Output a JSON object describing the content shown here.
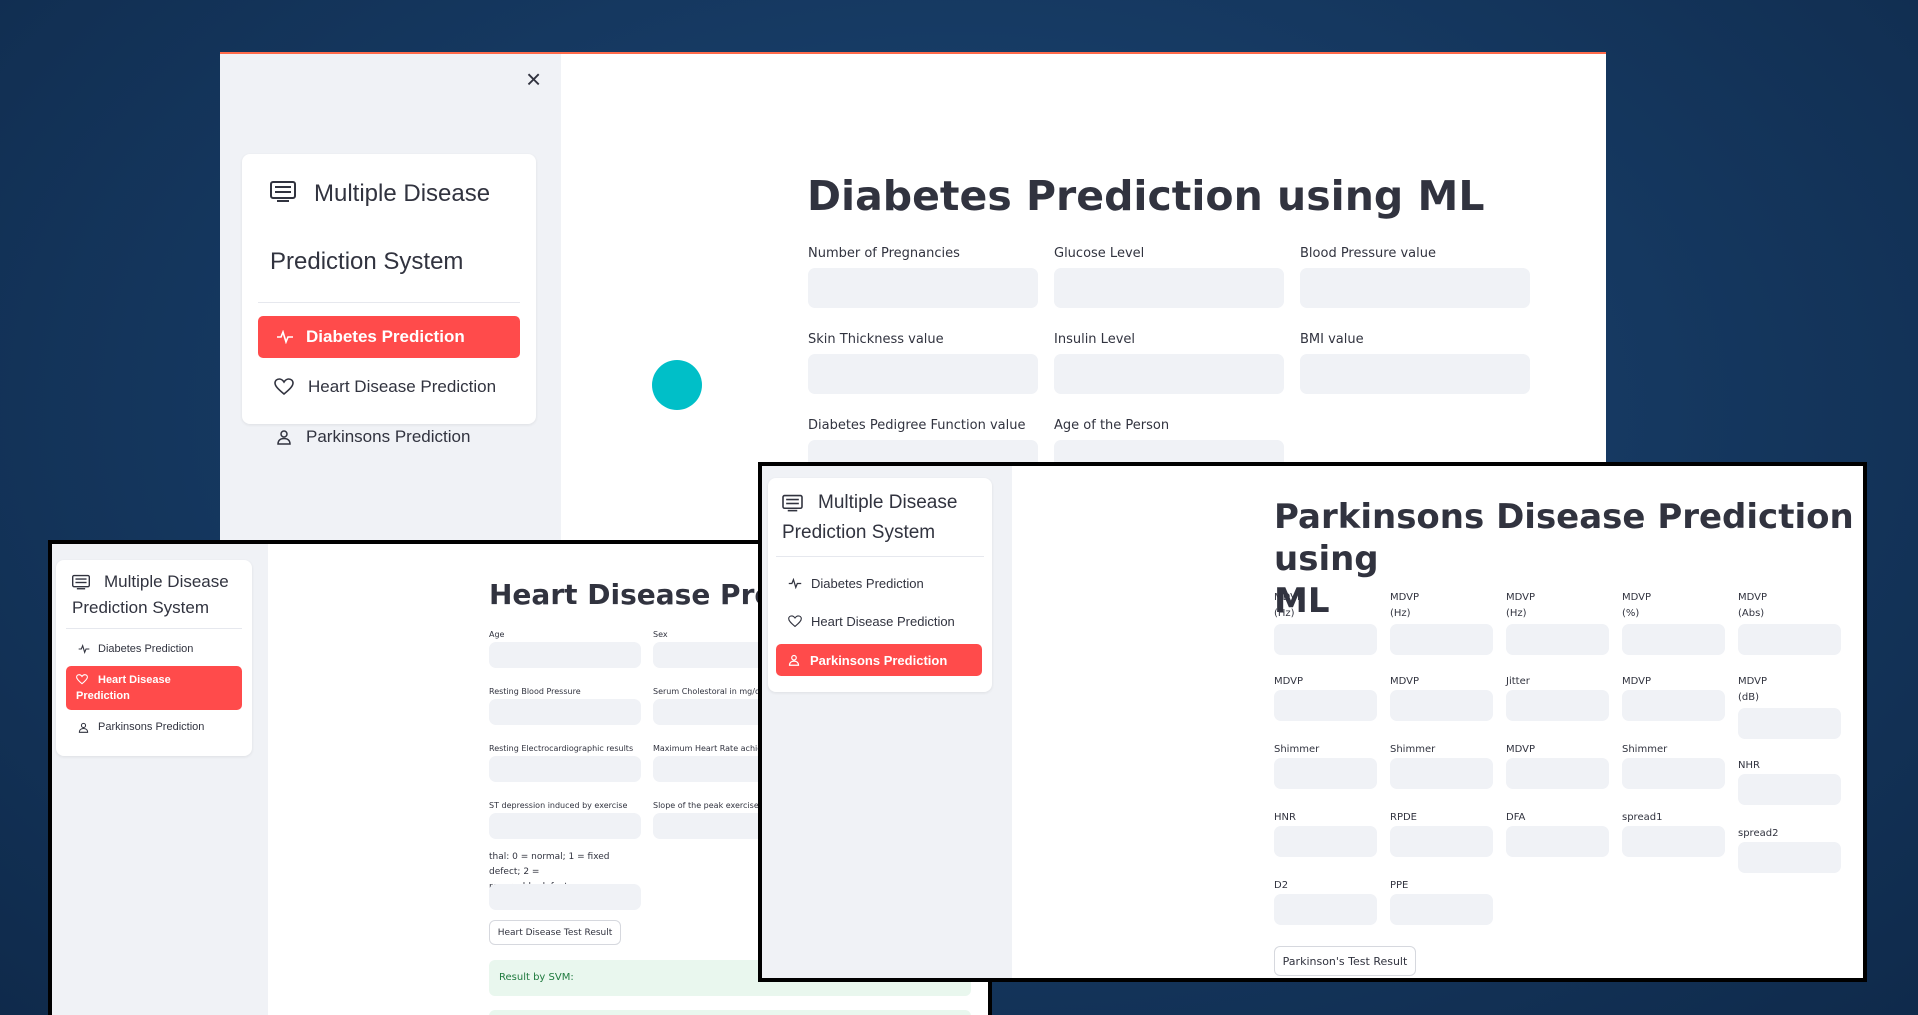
{
  "app": {
    "title": "Multiple Disease Prediction System",
    "title_line1": "Multiple Disease",
    "title_line2": "Prediction System",
    "menu": [
      {
        "label": "Diabetes Prediction",
        "icon": "activity-icon"
      },
      {
        "label": "Heart Disease Prediction",
        "icon": "heart-icon"
      },
      {
        "label": "Parkinsons Prediction",
        "icon": "person-icon"
      }
    ],
    "accent": "#ff4b4b"
  },
  "diabetes": {
    "close_label": "×",
    "title": "Diabetes Prediction using ML",
    "fields": [
      "Number of Pregnancies",
      "Glucose Level",
      "Blood Pressure value",
      "Skin Thickness value",
      "Insulin Level",
      "BMI value",
      "Diabetes Pedigree Function value",
      "Age of the Person"
    ]
  },
  "heart": {
    "title": "Heart Disease Predic",
    "active_line1": "Heart Disease",
    "active_line2": "Prediction",
    "fields": [
      "Age",
      "Sex",
      "Resting Blood Pressure",
      "Serum Cholestoral in mg/d",
      "Resting Electrocardiographic results",
      "Maximum Heart Rate achie",
      "ST depression induced by exercise",
      "Slope of the peak exercise"
    ],
    "thal_line1": "thal: 0 = normal; 1 = fixed defect; 2 =",
    "thal_line2": "reversable defect",
    "button": "Heart Disease Test Result",
    "result": "Result by SVM:"
  },
  "parkinsons": {
    "title_line1": "Parkinsons Disease Prediction using",
    "title_line2": "ML",
    "fields": [
      {
        "l1": "MDVP",
        "l2": "(Hz)"
      },
      {
        "l1": "MDVP",
        "l2": "(Hz)"
      },
      {
        "l1": "MDVP",
        "l2": "(Hz)"
      },
      {
        "l1": "MDVP",
        "l2": "(%)"
      },
      {
        "l1": "MDVP",
        "l2": "(Abs)"
      },
      {
        "l1": "MDVP",
        "l2": ""
      },
      {
        "l1": "MDVP",
        "l2": ""
      },
      {
        "l1": "Jitter",
        "l2": ""
      },
      {
        "l1": "MDVP",
        "l2": ""
      },
      {
        "l1": "MDVP",
        "l2": "(dB)"
      },
      {
        "l1": "Shimmer",
        "l2": ""
      },
      {
        "l1": "Shimmer",
        "l2": ""
      },
      {
        "l1": "MDVP",
        "l2": ""
      },
      {
        "l1": "Shimmer",
        "l2": ""
      },
      {
        "l1": "NHR",
        "l2": ""
      },
      {
        "l1": "HNR",
        "l2": ""
      },
      {
        "l1": "RPDE",
        "l2": ""
      },
      {
        "l1": "DFA",
        "l2": ""
      },
      {
        "l1": "spread1",
        "l2": ""
      },
      {
        "l1": "spread2",
        "l2": ""
      },
      {
        "l1": "D2",
        "l2": ""
      },
      {
        "l1": "PPE",
        "l2": ""
      }
    ],
    "button": "Parkinson's Test Result"
  }
}
